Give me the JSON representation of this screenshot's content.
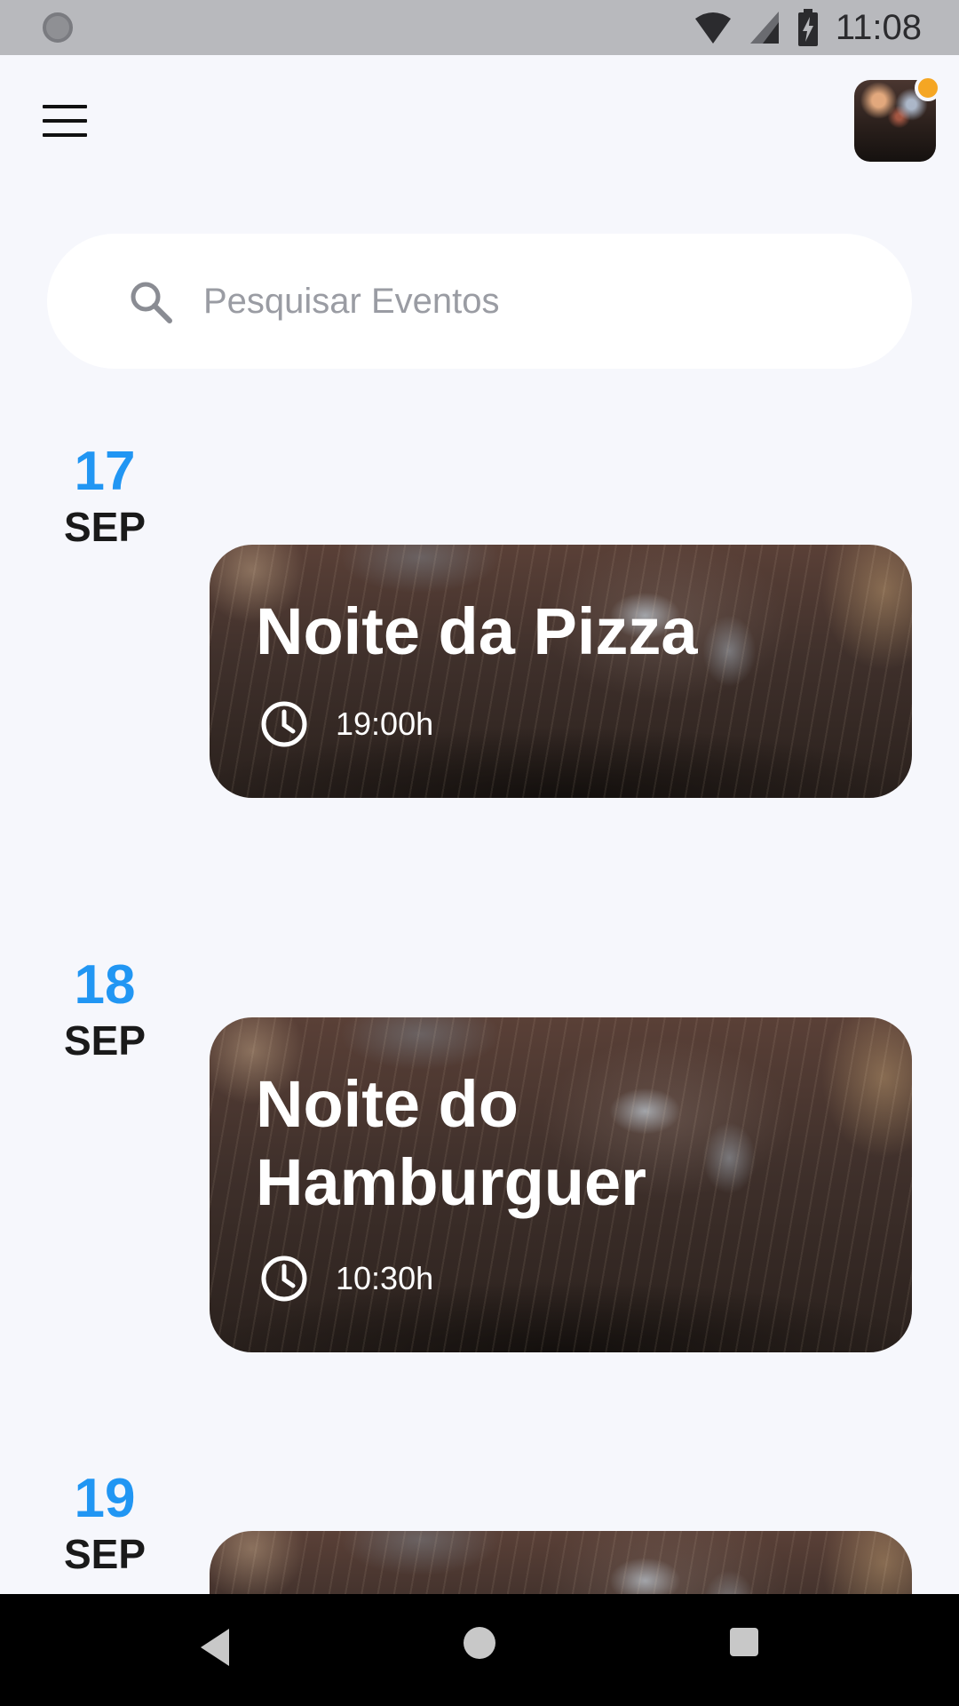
{
  "status_bar": {
    "time": "11:08"
  },
  "search": {
    "placeholder": "Pesquisar Eventos"
  },
  "events": [
    {
      "day": "17",
      "month": "SEP",
      "title": "Noite da Pizza",
      "time": "19:00h"
    },
    {
      "day": "18",
      "month": "SEP",
      "title": "Noite do Hamburguer",
      "time": "10:30h"
    },
    {
      "day": "19",
      "month": "SEP",
      "title": "",
      "time": ""
    }
  ],
  "colors": {
    "accent": "#2196f3",
    "badge": "#f5a623",
    "background": "#f6f7fc"
  }
}
